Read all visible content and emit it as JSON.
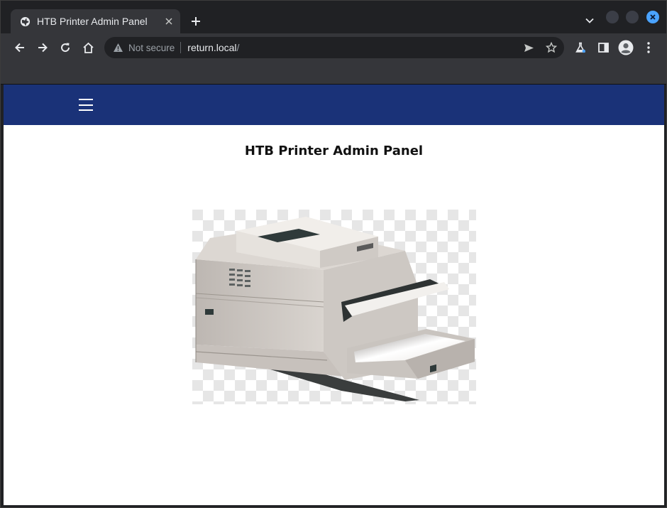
{
  "browser": {
    "tab_title": "HTB Printer Admin Panel",
    "tab_close": "✕",
    "new_tab": "+",
    "security_label": "Not secure",
    "url_host": "return.local",
    "url_path": "/",
    "icons": {
      "favicon": "globe-icon",
      "back": "arrow-left-icon",
      "forward": "arrow-right-icon",
      "reload": "reload-icon",
      "home": "home-icon",
      "warning": "warning-triangle-icon",
      "send": "send-icon",
      "bookmark": "star-icon",
      "labs": "flask-icon",
      "side_panel": "side-panel-icon",
      "profile": "profile-icon",
      "menu": "kebab-menu-icon"
    },
    "colors": {
      "close_button": "#4aa3ff"
    }
  },
  "page": {
    "navbar_color": "#1a3278",
    "title": "HTB Printer Admin Panel",
    "menu_icon": "hamburger-icon",
    "image": "printer-illustration"
  }
}
